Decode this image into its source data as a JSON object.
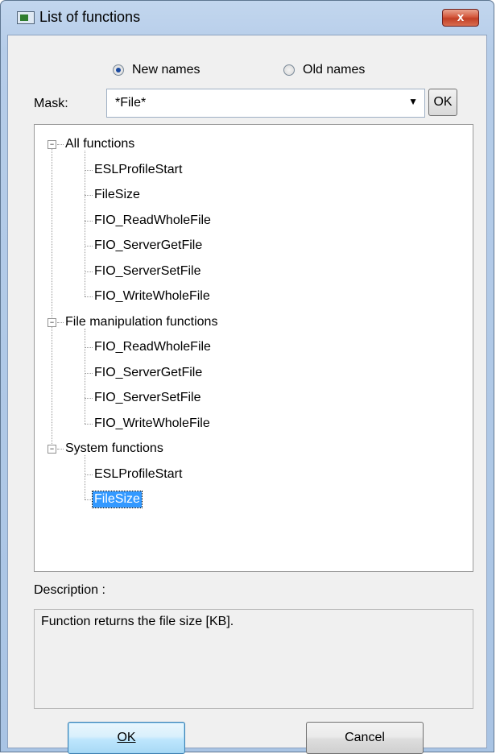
{
  "window": {
    "title": "List of functions",
    "close_label": "x"
  },
  "mode": {
    "options": [
      "New names",
      "Old names"
    ],
    "selected": "New names"
  },
  "mask": {
    "label": "Mask:",
    "value": "*File*",
    "ok_label": "OK"
  },
  "tree": {
    "groups": [
      {
        "label": "All functions",
        "items": [
          "ESLProfileStart",
          "FileSize",
          "FIO_ReadWholeFile",
          "FIO_ServerGetFile",
          "FIO_ServerSetFile",
          "FIO_WriteWholeFile"
        ]
      },
      {
        "label": "File manipulation functions",
        "items": [
          "FIO_ReadWholeFile",
          "FIO_ServerGetFile",
          "FIO_ServerSetFile",
          "FIO_WriteWholeFile"
        ]
      },
      {
        "label": "System functions",
        "items": [
          "ESLProfileStart",
          "FileSize"
        ]
      }
    ],
    "selected": "FileSize"
  },
  "description": {
    "label": "Description :",
    "text": "Function returns the file size [KB]."
  },
  "buttons": {
    "ok_label": "OK",
    "cancel_label": "Cancel"
  },
  "colors": {
    "selection": "#3399ff",
    "close_button": "#c23f25"
  }
}
